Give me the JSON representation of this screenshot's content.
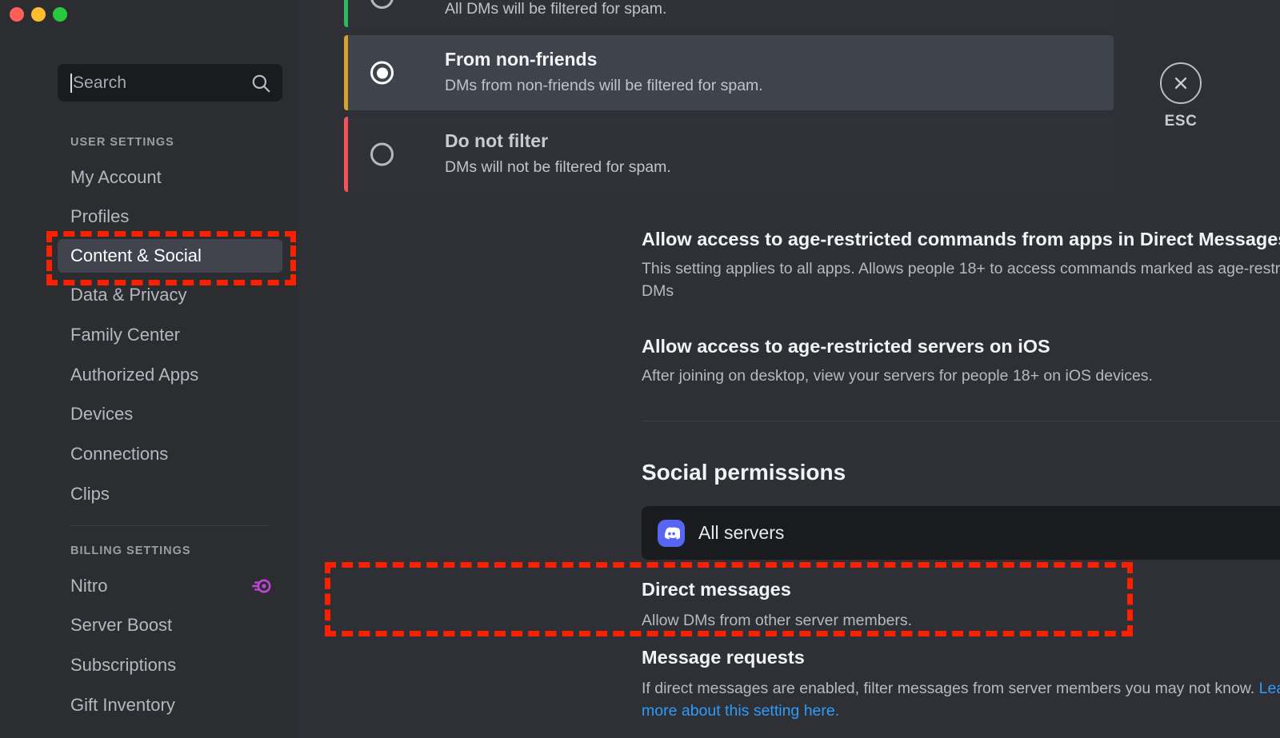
{
  "window": {
    "traffic_lights": [
      "close",
      "minimize",
      "zoom"
    ],
    "colors": {
      "close": "#ff5f57",
      "minimize": "#febc2e",
      "zoom": "#28c840"
    }
  },
  "sidebar": {
    "search": {
      "placeholder": "Search",
      "icon": "search-icon",
      "value": ""
    },
    "groups": [
      {
        "heading": "USER SETTINGS",
        "items": [
          {
            "label": "My Account",
            "active": false
          },
          {
            "label": "Profiles",
            "active": false
          },
          {
            "label": "Content & Social",
            "active": true
          },
          {
            "label": "Data & Privacy",
            "active": false
          },
          {
            "label": "Family Center",
            "active": false
          },
          {
            "label": "Authorized Apps",
            "active": false
          },
          {
            "label": "Devices",
            "active": false
          },
          {
            "label": "Connections",
            "active": false
          },
          {
            "label": "Clips",
            "active": false
          }
        ]
      },
      {
        "heading": "BILLING SETTINGS",
        "items": [
          {
            "label": "Nitro",
            "active": false,
            "badge": "nitro-badge-icon"
          },
          {
            "label": "Server Boost",
            "active": false
          },
          {
            "label": "Subscriptions",
            "active": false
          },
          {
            "label": "Gift Inventory",
            "active": false
          }
        ]
      }
    ]
  },
  "close": {
    "label": "ESC",
    "icon": "close-icon"
  },
  "main": {
    "spam_filter_options": [
      {
        "title": "",
        "desc": "All DMs will be filtered for spam.",
        "selected": false,
        "accent": "#2eb85f",
        "partial": true
      },
      {
        "title": "From non-friends",
        "desc": "DMs from non-friends will be filtered for spam.",
        "selected": true,
        "accent": "#d9a22b",
        "partial": false
      },
      {
        "title": "Do not filter",
        "desc": "DMs will not be filtered for spam.",
        "selected": false,
        "accent": "#f4525a",
        "partial": false
      }
    ],
    "toggle_settings": [
      {
        "title": "Allow access to age-restricted commands from apps in Direct Messages",
        "desc": "This setting applies to all apps. Allows people 18+ to access commands marked as age-restricted in DMs",
        "on": false
      },
      {
        "title": "Allow access to age-restricted servers on iOS",
        "desc": "After joining on desktop, view your servers for people 18+ on iOS devices.",
        "on": false
      }
    ],
    "social_permissions": {
      "title": "Social permissions",
      "server_select": {
        "label": "All servers",
        "icon": "discord-logo-icon",
        "chevron": "chevron-down-icon"
      },
      "items": [
        {
          "title": "Direct messages",
          "desc": "Allow DMs from other server members.",
          "on": true,
          "link_text": "",
          "link_tail": ""
        },
        {
          "title": "Message requests",
          "desc": "If direct messages are enabled, filter messages from server members you may not know. ",
          "link_text": "Learn more about this setting here.",
          "on": true
        }
      ]
    }
  },
  "annotations": {
    "color": "#fa2000",
    "boxes": [
      {
        "name": "sidebar-content-social-highlight"
      },
      {
        "name": "direct-messages-highlight"
      }
    ]
  }
}
